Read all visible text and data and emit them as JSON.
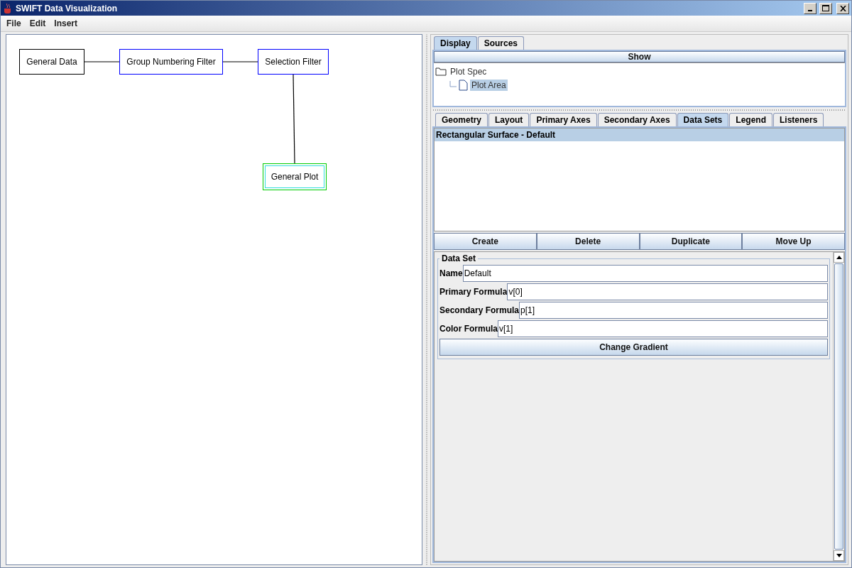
{
  "window": {
    "title": "SWIFT Data Visualization"
  },
  "menu": [
    "File",
    "Edit",
    "Insert"
  ],
  "diagram": {
    "nodes": [
      {
        "label": "General Data",
        "kind": "data",
        "selected": false
      },
      {
        "label": "Group Numbering Filter",
        "kind": "filter",
        "selected": false
      },
      {
        "label": "Selection Filter",
        "kind": "filter",
        "selected": false
      },
      {
        "label": "General Plot",
        "kind": "plot",
        "selected": true
      }
    ]
  },
  "top_tabs": [
    {
      "label": "Display",
      "selected": true
    },
    {
      "label": "Sources",
      "selected": false
    }
  ],
  "show_button": "Show",
  "tree": [
    {
      "label": "Plot Spec",
      "expanded": true,
      "selected": false,
      "children": [
        {
          "label": "Plot Area",
          "selected": true
        }
      ]
    }
  ],
  "lower_tabs": [
    {
      "label": "Geometry",
      "selected": false
    },
    {
      "label": "Layout",
      "selected": false
    },
    {
      "label": "Primary Axes",
      "selected": false
    },
    {
      "label": "Secondary Axes",
      "selected": false
    },
    {
      "label": "Data Sets",
      "selected": true
    },
    {
      "label": "Legend",
      "selected": false
    },
    {
      "label": "Listeners",
      "selected": false
    }
  ],
  "data_sets": [
    {
      "label": "Rectangular Surface - Default",
      "selected": true
    }
  ],
  "actions": [
    "Create",
    "Delete",
    "Duplicate",
    "Move Up"
  ],
  "data_set": {
    "title": "Data Set",
    "fields": [
      {
        "label": "Name",
        "value": "Default"
      },
      {
        "label": "Primary Formula",
        "value": "v[0]"
      },
      {
        "label": "Secondary Formula",
        "value": "p[1]"
      },
      {
        "label": "Color Formula",
        "value": "v[1]"
      }
    ],
    "button": "Change Gradient"
  }
}
